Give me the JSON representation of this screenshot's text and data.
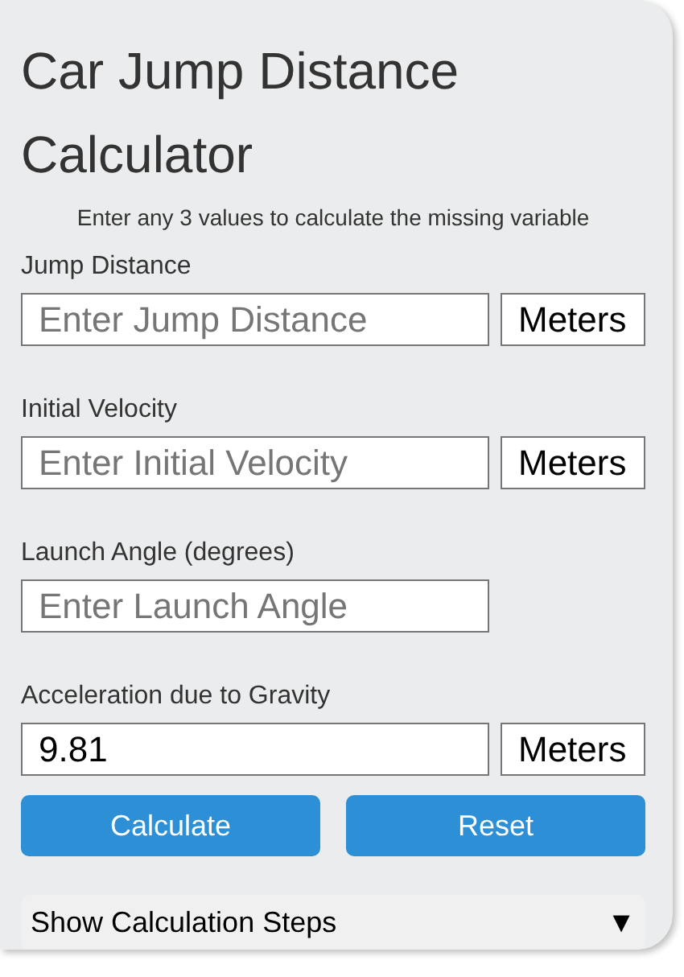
{
  "title": "Car Jump Distance Calculator",
  "subtitle": "Enter any 3 values to calculate the missing variable",
  "fields": [
    {
      "kind": "unit",
      "label": "Jump Distance",
      "placeholder": "Enter Jump Distance",
      "unit": "Meters"
    },
    {
      "kind": "unit",
      "label": "Initial Velocity",
      "placeholder": "Enter Initial Velocity",
      "unit": "Meters"
    },
    {
      "kind": "plain",
      "label": "Launch Angle (degrees)",
      "placeholder": "Enter Launch Angle"
    },
    {
      "kind": "unit",
      "label": "Acceleration due to Gravity",
      "value": "9.81",
      "unit": "Meters"
    }
  ],
  "buttons": [
    "Calculate",
    "Reset"
  ],
  "steps": {
    "label": "Show Calculation Steps",
    "toggle": "▼"
  }
}
